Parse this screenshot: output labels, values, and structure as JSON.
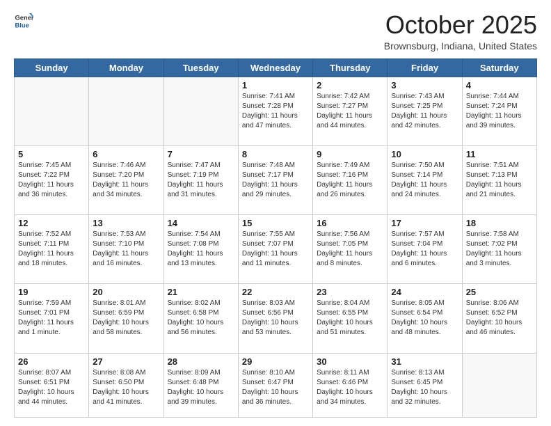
{
  "header": {
    "logo_general": "General",
    "logo_blue": "Blue",
    "month_title": "October 2025",
    "subtitle": "Brownsburg, Indiana, United States"
  },
  "days_of_week": [
    "Sunday",
    "Monday",
    "Tuesday",
    "Wednesday",
    "Thursday",
    "Friday",
    "Saturday"
  ],
  "weeks": [
    [
      {
        "day": "",
        "info": ""
      },
      {
        "day": "",
        "info": ""
      },
      {
        "day": "",
        "info": ""
      },
      {
        "day": "1",
        "info": "Sunrise: 7:41 AM\nSunset: 7:28 PM\nDaylight: 11 hours and 47 minutes."
      },
      {
        "day": "2",
        "info": "Sunrise: 7:42 AM\nSunset: 7:27 PM\nDaylight: 11 hours and 44 minutes."
      },
      {
        "day": "3",
        "info": "Sunrise: 7:43 AM\nSunset: 7:25 PM\nDaylight: 11 hours and 42 minutes."
      },
      {
        "day": "4",
        "info": "Sunrise: 7:44 AM\nSunset: 7:24 PM\nDaylight: 11 hours and 39 minutes."
      }
    ],
    [
      {
        "day": "5",
        "info": "Sunrise: 7:45 AM\nSunset: 7:22 PM\nDaylight: 11 hours and 36 minutes."
      },
      {
        "day": "6",
        "info": "Sunrise: 7:46 AM\nSunset: 7:20 PM\nDaylight: 11 hours and 34 minutes."
      },
      {
        "day": "7",
        "info": "Sunrise: 7:47 AM\nSunset: 7:19 PM\nDaylight: 11 hours and 31 minutes."
      },
      {
        "day": "8",
        "info": "Sunrise: 7:48 AM\nSunset: 7:17 PM\nDaylight: 11 hours and 29 minutes."
      },
      {
        "day": "9",
        "info": "Sunrise: 7:49 AM\nSunset: 7:16 PM\nDaylight: 11 hours and 26 minutes."
      },
      {
        "day": "10",
        "info": "Sunrise: 7:50 AM\nSunset: 7:14 PM\nDaylight: 11 hours and 24 minutes."
      },
      {
        "day": "11",
        "info": "Sunrise: 7:51 AM\nSunset: 7:13 PM\nDaylight: 11 hours and 21 minutes."
      }
    ],
    [
      {
        "day": "12",
        "info": "Sunrise: 7:52 AM\nSunset: 7:11 PM\nDaylight: 11 hours and 18 minutes."
      },
      {
        "day": "13",
        "info": "Sunrise: 7:53 AM\nSunset: 7:10 PM\nDaylight: 11 hours and 16 minutes."
      },
      {
        "day": "14",
        "info": "Sunrise: 7:54 AM\nSunset: 7:08 PM\nDaylight: 11 hours and 13 minutes."
      },
      {
        "day": "15",
        "info": "Sunrise: 7:55 AM\nSunset: 7:07 PM\nDaylight: 11 hours and 11 minutes."
      },
      {
        "day": "16",
        "info": "Sunrise: 7:56 AM\nSunset: 7:05 PM\nDaylight: 11 hours and 8 minutes."
      },
      {
        "day": "17",
        "info": "Sunrise: 7:57 AM\nSunset: 7:04 PM\nDaylight: 11 hours and 6 minutes."
      },
      {
        "day": "18",
        "info": "Sunrise: 7:58 AM\nSunset: 7:02 PM\nDaylight: 11 hours and 3 minutes."
      }
    ],
    [
      {
        "day": "19",
        "info": "Sunrise: 7:59 AM\nSunset: 7:01 PM\nDaylight: 11 hours and 1 minute."
      },
      {
        "day": "20",
        "info": "Sunrise: 8:01 AM\nSunset: 6:59 PM\nDaylight: 10 hours and 58 minutes."
      },
      {
        "day": "21",
        "info": "Sunrise: 8:02 AM\nSunset: 6:58 PM\nDaylight: 10 hours and 56 minutes."
      },
      {
        "day": "22",
        "info": "Sunrise: 8:03 AM\nSunset: 6:56 PM\nDaylight: 10 hours and 53 minutes."
      },
      {
        "day": "23",
        "info": "Sunrise: 8:04 AM\nSunset: 6:55 PM\nDaylight: 10 hours and 51 minutes."
      },
      {
        "day": "24",
        "info": "Sunrise: 8:05 AM\nSunset: 6:54 PM\nDaylight: 10 hours and 48 minutes."
      },
      {
        "day": "25",
        "info": "Sunrise: 8:06 AM\nSunset: 6:52 PM\nDaylight: 10 hours and 46 minutes."
      }
    ],
    [
      {
        "day": "26",
        "info": "Sunrise: 8:07 AM\nSunset: 6:51 PM\nDaylight: 10 hours and 44 minutes."
      },
      {
        "day": "27",
        "info": "Sunrise: 8:08 AM\nSunset: 6:50 PM\nDaylight: 10 hours and 41 minutes."
      },
      {
        "day": "28",
        "info": "Sunrise: 8:09 AM\nSunset: 6:48 PM\nDaylight: 10 hours and 39 minutes."
      },
      {
        "day": "29",
        "info": "Sunrise: 8:10 AM\nSunset: 6:47 PM\nDaylight: 10 hours and 36 minutes."
      },
      {
        "day": "30",
        "info": "Sunrise: 8:11 AM\nSunset: 6:46 PM\nDaylight: 10 hours and 34 minutes."
      },
      {
        "day": "31",
        "info": "Sunrise: 8:13 AM\nSunset: 6:45 PM\nDaylight: 10 hours and 32 minutes."
      },
      {
        "day": "",
        "info": ""
      }
    ]
  ],
  "colors": {
    "header_bg": "#3369a0",
    "header_text": "#ffffff",
    "accent_blue": "#1a5faa"
  }
}
